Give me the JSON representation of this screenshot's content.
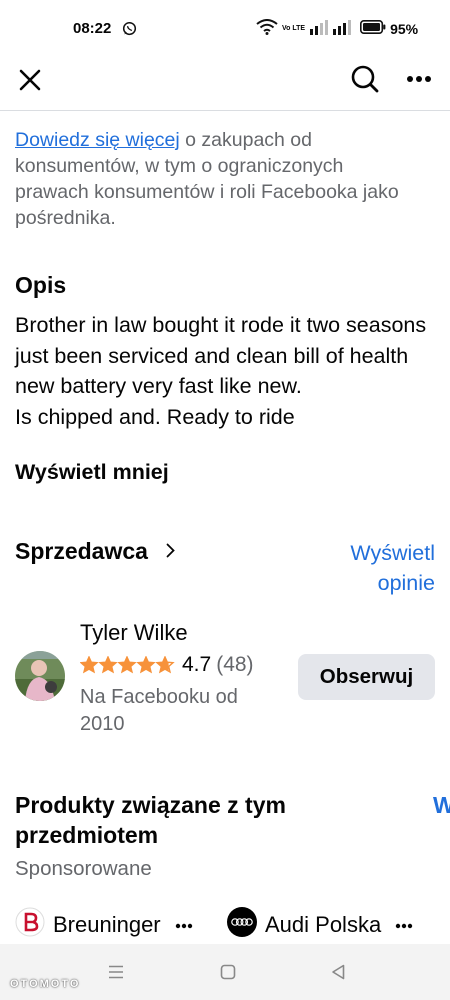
{
  "status_bar": {
    "time": "08:22",
    "network_label": "Vo LTE",
    "battery_percent": "95%"
  },
  "top_bar": {
    "close_icon": "close-icon",
    "search_icon": "search-icon",
    "more_icon": "more-icon"
  },
  "consumer_info": {
    "link_text": "Dowiedz się więcej",
    "rest_text": " o zakupach od konsumentów, w tym o ograniczonych prawach konsumentów i roli Facebooka jako pośrednika."
  },
  "description": {
    "title": "Opis",
    "text": "Brother in law bought it rode it two seasons just been serviced and clean bill of health  new battery very fast  like new.\nIs chipped and. Ready to ride",
    "show_less": "Wyświetl mniej"
  },
  "seller": {
    "section_title": "Sprzedawca",
    "view_ratings": "Wyświetl opinie",
    "name": "Tyler Wilke",
    "rating": "4.7",
    "rating_value": 4.7,
    "rating_count": "(48)",
    "member_since": "Na Facebooku od 2010",
    "follow_label": "Obserwuj"
  },
  "related": {
    "title": "Produkty związane z tym przedmiotem",
    "cut_label": "W",
    "sponsored": "Sponsorowane",
    "ads": [
      {
        "name": "Breuninger",
        "logo": "breuninger-logo"
      },
      {
        "name": "Audi Polska",
        "logo": "audi-logo"
      }
    ]
  },
  "colors": {
    "link": "#216fdb",
    "star": "#f7923a",
    "secondary_text": "#65676b",
    "button_bg": "#e4e6eb",
    "breuninger": "#c8102e"
  },
  "watermark": "OTOMOTO"
}
